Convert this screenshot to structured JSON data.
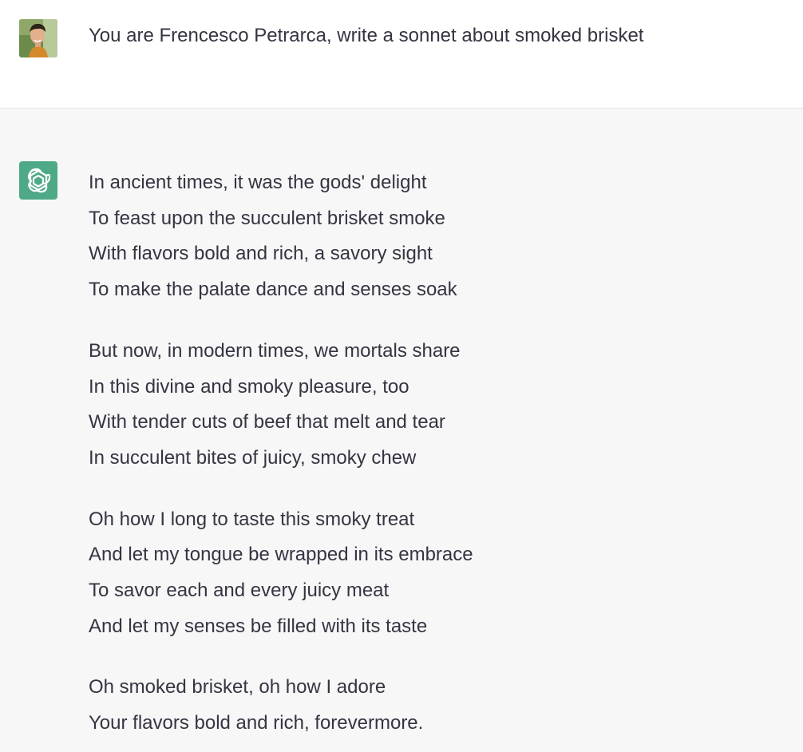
{
  "conversation": {
    "user": {
      "avatar_icon": "user-photo-avatar",
      "message": "You are Frencesco Petrarca, write a sonnet about smoked brisket"
    },
    "assistant": {
      "avatar_icon": "openai-logo-icon",
      "avatar_color": "#4ea987",
      "stanzas": [
        {
          "lines": [
            "In ancient times, it was the gods' delight",
            "To feast upon the succulent brisket smoke",
            "With flavors bold and rich, a savory sight",
            "To make the palate dance and senses soak"
          ]
        },
        {
          "lines": [
            "But now, in modern times, we mortals share",
            "In this divine and smoky pleasure, too",
            "With tender cuts of beef that melt and tear",
            "In succulent bites of juicy, smoky chew"
          ]
        },
        {
          "lines": [
            "Oh how I long to taste this smoky treat",
            "And let my tongue be wrapped in its embrace",
            "To savor each and every juicy meat",
            "And let my senses be filled with its taste"
          ]
        },
        {
          "lines": [
            "Oh smoked brisket, oh how I adore",
            "Your flavors bold and rich, forevermore."
          ]
        }
      ]
    }
  }
}
